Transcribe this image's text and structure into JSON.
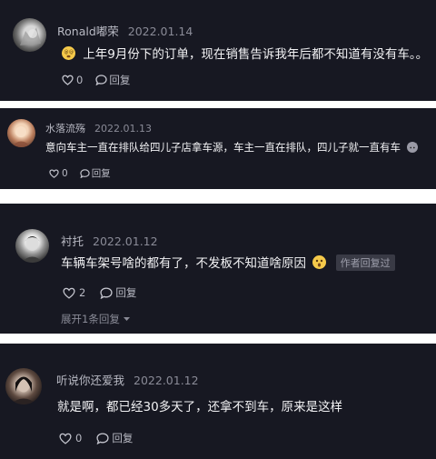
{
  "comments": [
    {
      "username": "Ronald嘟荣",
      "date": "2022.01.14",
      "text": "上年9月份下的订单，现在销售告诉我年后都不知道有没有车。。",
      "likes": "0",
      "reply_label": "回复",
      "emoji": "dizzy-face"
    },
    {
      "username": "水落流殇",
      "date": "2022.01.13",
      "text": "意向车主一直在排队给四儿子店拿车源，车主一直在排队，四儿子就一直有车",
      "likes": "0",
      "reply_label": "回复",
      "emoji": "cat-face"
    },
    {
      "username": "衬托",
      "date": "2022.01.12",
      "text": "车辆车架号啥的都有了，不发板不知道啥原因",
      "likes": "2",
      "reply_label": "回复",
      "emoji": "astonished-face",
      "author_tag": "作者回复过",
      "expand_label": "展开1条回复"
    },
    {
      "username": "听说你还爱我",
      "date": "2022.01.12",
      "text": "就是啊，都已经30多天了，还拿不到车，原来是这样",
      "likes": "0",
      "reply_label": "回复"
    }
  ],
  "colors": {
    "card_bg": "#171822",
    "separator": "#ffffff",
    "username": "#b9bac4",
    "date": "#8a8b97",
    "text": "#f2f2f4",
    "tag_bg": "#393a45"
  }
}
